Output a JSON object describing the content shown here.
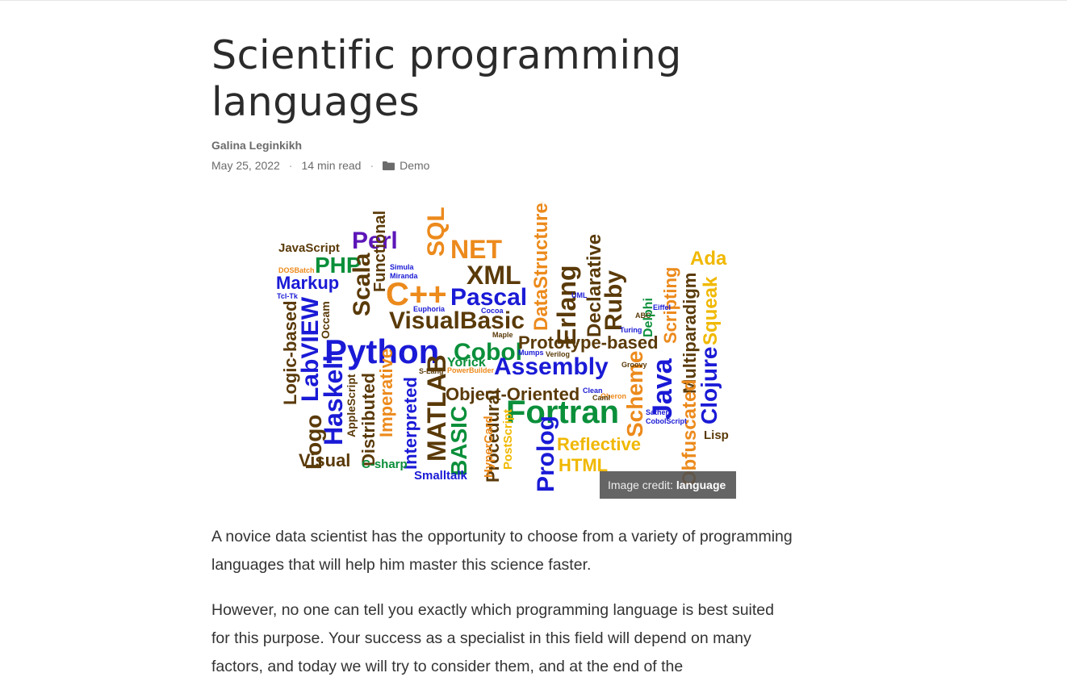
{
  "article": {
    "title_line1": "Scientific programming",
    "title_line2": "languages",
    "author": "Galina Leginkikh",
    "date": "May 25, 2022",
    "separator": "·",
    "read_time": "14 min read",
    "category": "Demo",
    "category_icon": "folder-icon"
  },
  "image": {
    "caption_prefix": "Image credit: ",
    "caption_link": "language"
  },
  "paragraphs": [
    "A novice data scientist has the opportunity to choose from a variety of programming languages that will help him master this science faster.",
    "However, no one can tell you exactly which programming language is best suited for this purpose. Your success as a specialist in this field will depend on many factors, and today we will try to consider them, and at the end of the"
  ],
  "colors": {
    "blue": "#1a1ad6",
    "orange": "#ec8a1c",
    "green": "#0a8f3a",
    "brown": "#5a3a08",
    "gold": "#f0b800",
    "purple": "#5c16b8",
    "red": "#c0301a"
  },
  "word_cloud": [
    {
      "text": "JavaScript",
      "color": "brown"
    },
    {
      "text": "Perl",
      "color": "purple"
    },
    {
      "text": "PHP",
      "color": "green"
    },
    {
      "text": "Markup",
      "color": "blue"
    },
    {
      "text": "SQL",
      "color": "orange"
    },
    {
      "text": "NET",
      "color": "orange"
    },
    {
      "text": "C++",
      "color": "orange"
    },
    {
      "text": "XML",
      "color": "brown"
    },
    {
      "text": "Pascal",
      "color": "blue"
    },
    {
      "text": "DataStructured",
      "color": "orange"
    },
    {
      "text": "Erlang",
      "color": "brown"
    },
    {
      "text": "Declarative",
      "color": "brown"
    },
    {
      "text": "Ruby",
      "color": "brown"
    },
    {
      "text": "Scripting",
      "color": "orange"
    },
    {
      "text": "Ada",
      "color": "gold"
    },
    {
      "text": "Squeak",
      "color": "gold"
    },
    {
      "text": "Multiparadigm",
      "color": "brown"
    },
    {
      "text": "Functional",
      "color": "brown"
    },
    {
      "text": "Scala",
      "color": "brown"
    },
    {
      "text": "VisualBasic",
      "color": "brown"
    },
    {
      "text": "LabVIEW",
      "color": "blue"
    },
    {
      "text": "Logic-based",
      "color": "brown"
    },
    {
      "text": "Python",
      "color": "blue"
    },
    {
      "text": "Cobol",
      "color": "green"
    },
    {
      "text": "Prototype-based",
      "color": "brown"
    },
    {
      "text": "MATLAB",
      "color": "brown"
    },
    {
      "text": "Assembly",
      "color": "blue"
    },
    {
      "text": "Java",
      "color": "blue"
    },
    {
      "text": "Clojure",
      "color": "blue"
    },
    {
      "text": "Haskell",
      "color": "blue"
    },
    {
      "text": "Logo",
      "color": "brown"
    },
    {
      "text": "Object-Oriented",
      "color": "brown"
    },
    {
      "text": "Fortran",
      "color": "green"
    },
    {
      "text": "Scheme",
      "color": "orange"
    },
    {
      "text": "Obfuscated",
      "color": "orange"
    },
    {
      "text": "BASIC",
      "color": "green"
    },
    {
      "text": "Interpreted",
      "color": "blue"
    },
    {
      "text": "Imperative",
      "color": "orange"
    },
    {
      "text": "Distributed",
      "color": "brown"
    },
    {
      "text": "Prolog",
      "color": "blue"
    },
    {
      "text": "Reflective",
      "color": "gold"
    },
    {
      "text": "HTML",
      "color": "gold"
    },
    {
      "text": "Procedural",
      "color": "brown"
    },
    {
      "text": "PostScript",
      "color": "gold"
    },
    {
      "text": "Visual",
      "color": "brown"
    },
    {
      "text": "C-sharp",
      "color": "green"
    },
    {
      "text": "Smalltalk",
      "color": "blue"
    },
    {
      "text": "Lisp",
      "color": "brown"
    },
    {
      "text": "Yorick",
      "color": "green"
    },
    {
      "text": "HyperCard",
      "color": "orange"
    },
    {
      "text": "Delphi",
      "color": "green"
    },
    {
      "text": "Occam",
      "color": "brown"
    },
    {
      "text": "AppleScript",
      "color": "brown"
    },
    {
      "text": "Euphoria",
      "color": "blue"
    },
    {
      "text": "Simula",
      "color": "blue"
    },
    {
      "text": "Miranda",
      "color": "blue"
    },
    {
      "text": "DOSBatch",
      "color": "orange"
    },
    {
      "text": "Tcl-Tk",
      "color": "blue"
    },
    {
      "text": "Maple",
      "color": "brown"
    },
    {
      "text": "Mumps",
      "color": "blue"
    },
    {
      "text": "Verilog",
      "color": "brown"
    },
    {
      "text": "Groovy",
      "color": "brown"
    },
    {
      "text": "Eiffel",
      "color": "blue"
    },
    {
      "text": "Sather",
      "color": "blue"
    },
    {
      "text": "CobolScript",
      "color": "blue"
    },
    {
      "text": "S-Lang",
      "color": "brown"
    },
    {
      "text": "PowerBuilder",
      "color": "orange"
    },
    {
      "text": "Oberon",
      "color": "orange"
    },
    {
      "text": "Cocoa",
      "color": "blue"
    },
    {
      "text": "UML",
      "color": "blue"
    },
    {
      "text": "ABC",
      "color": "brown"
    },
    {
      "text": "Turing",
      "color": "blue"
    },
    {
      "text": "Clean",
      "color": "blue"
    },
    {
      "text": "Caml",
      "color": "brown"
    }
  ]
}
